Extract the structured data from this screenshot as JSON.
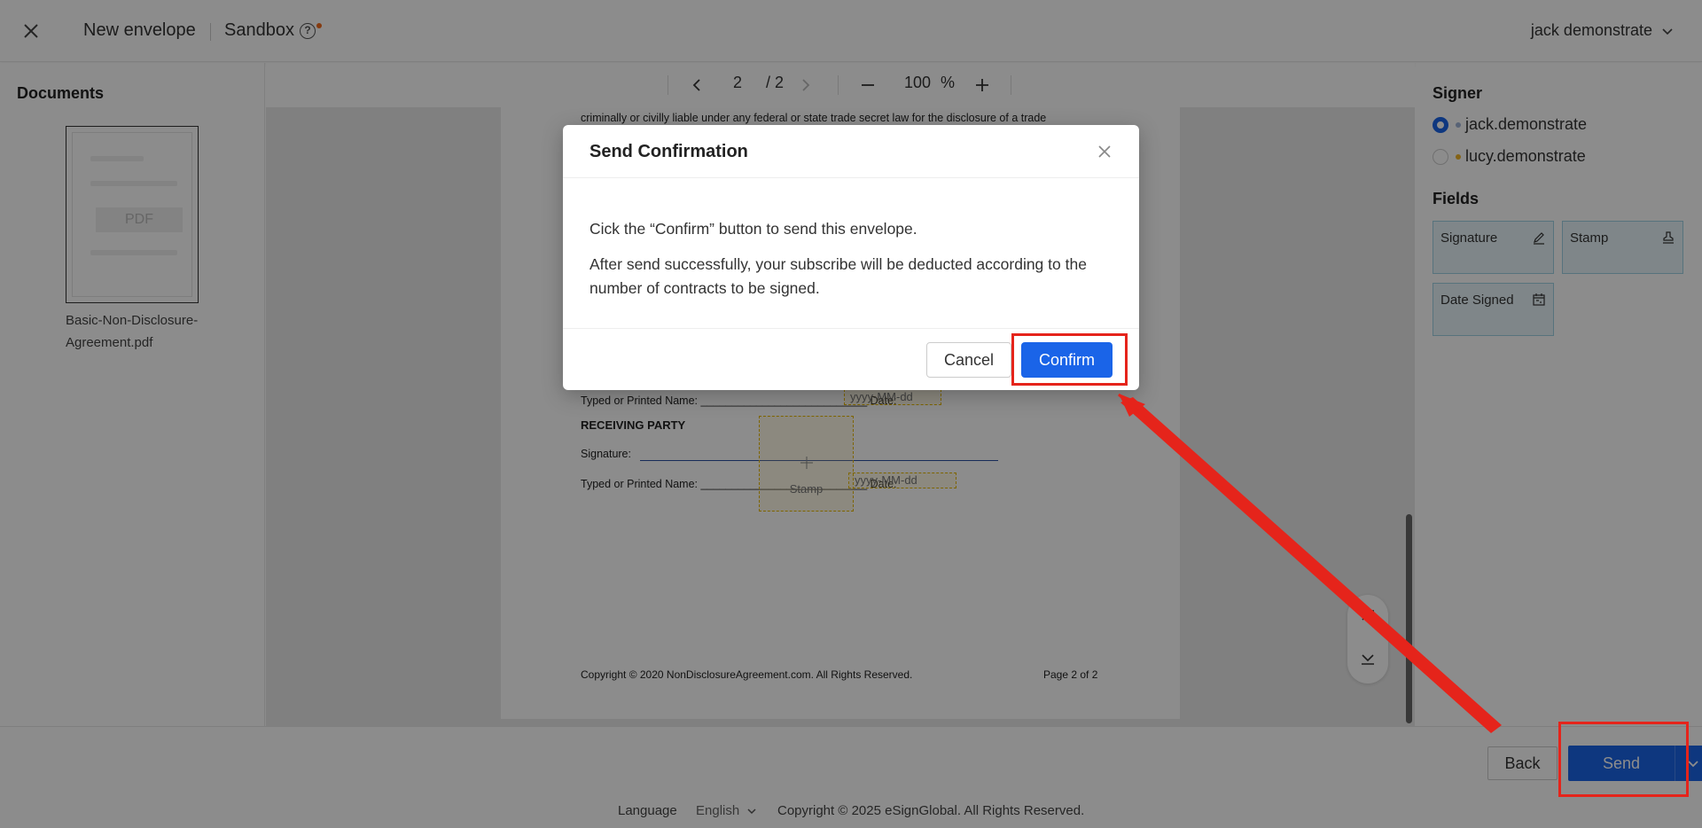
{
  "header": {
    "title": "New envelope",
    "sandbox": "Sandbox",
    "help": "?",
    "user": "jack demonstrate"
  },
  "documents": {
    "heading": "Documents",
    "thumb_label": "PDF",
    "file_name": "Basic-Non-Disclosure-Agreement.pdf"
  },
  "viewer": {
    "current_page": "2",
    "total_pages": "/ 2",
    "zoom": "100",
    "zoom_unit": "%"
  },
  "page_content": {
    "line1": "criminally or civilly liable under any federal or state trade secret law for the disclosure of a trade",
    "typed_name_1": "Typed or Printed Name: ___________________________ Date:",
    "date_placeholder_1": "yyyy-MM-dd",
    "receiving_party": "RECEIVING PARTY",
    "signature_label": "Signature:",
    "typed_name_2": "Typed or Printed Name: ___________________________ Date:",
    "date_placeholder_2": "yyyy-MM-dd",
    "stamp_label": "Stamp",
    "copyright": "Copyright © 2020 NonDisclosureAgreement.com. All Rights Reserved.",
    "page_footer": "Page 2 of 2"
  },
  "signer_panel": {
    "heading": "Signer",
    "signers": [
      {
        "name": "jack.demonstrate",
        "selected": true,
        "color": "#a0b4d8"
      },
      {
        "name": "lucy.demonstrate",
        "selected": false,
        "color": "#f0b429"
      }
    ]
  },
  "fields_panel": {
    "heading": "Fields",
    "items": [
      {
        "label": "Signature",
        "icon": "pen-icon"
      },
      {
        "label": "Stamp",
        "icon": "stamp-icon"
      },
      {
        "label": "Date Signed",
        "icon": "calendar-icon"
      }
    ]
  },
  "actions": {
    "back": "Back",
    "send": "Send"
  },
  "footer": {
    "language_label": "Language",
    "language_value": "English",
    "copyright": "Copyright © 2025 eSignGlobal. All Rights Reserved."
  },
  "modal": {
    "title": "Send Confirmation",
    "body_line1": "Cick the “Confirm” button to send this envelope.",
    "body_line2": "After send successfully, your subscribe will be deducted according to the number of contracts to be signed.",
    "cancel": "Cancel",
    "confirm": "Confirm"
  },
  "colors": {
    "primary": "#1a64e8",
    "annotation": "#e5241b",
    "field_bg": "#e8f5fa"
  }
}
